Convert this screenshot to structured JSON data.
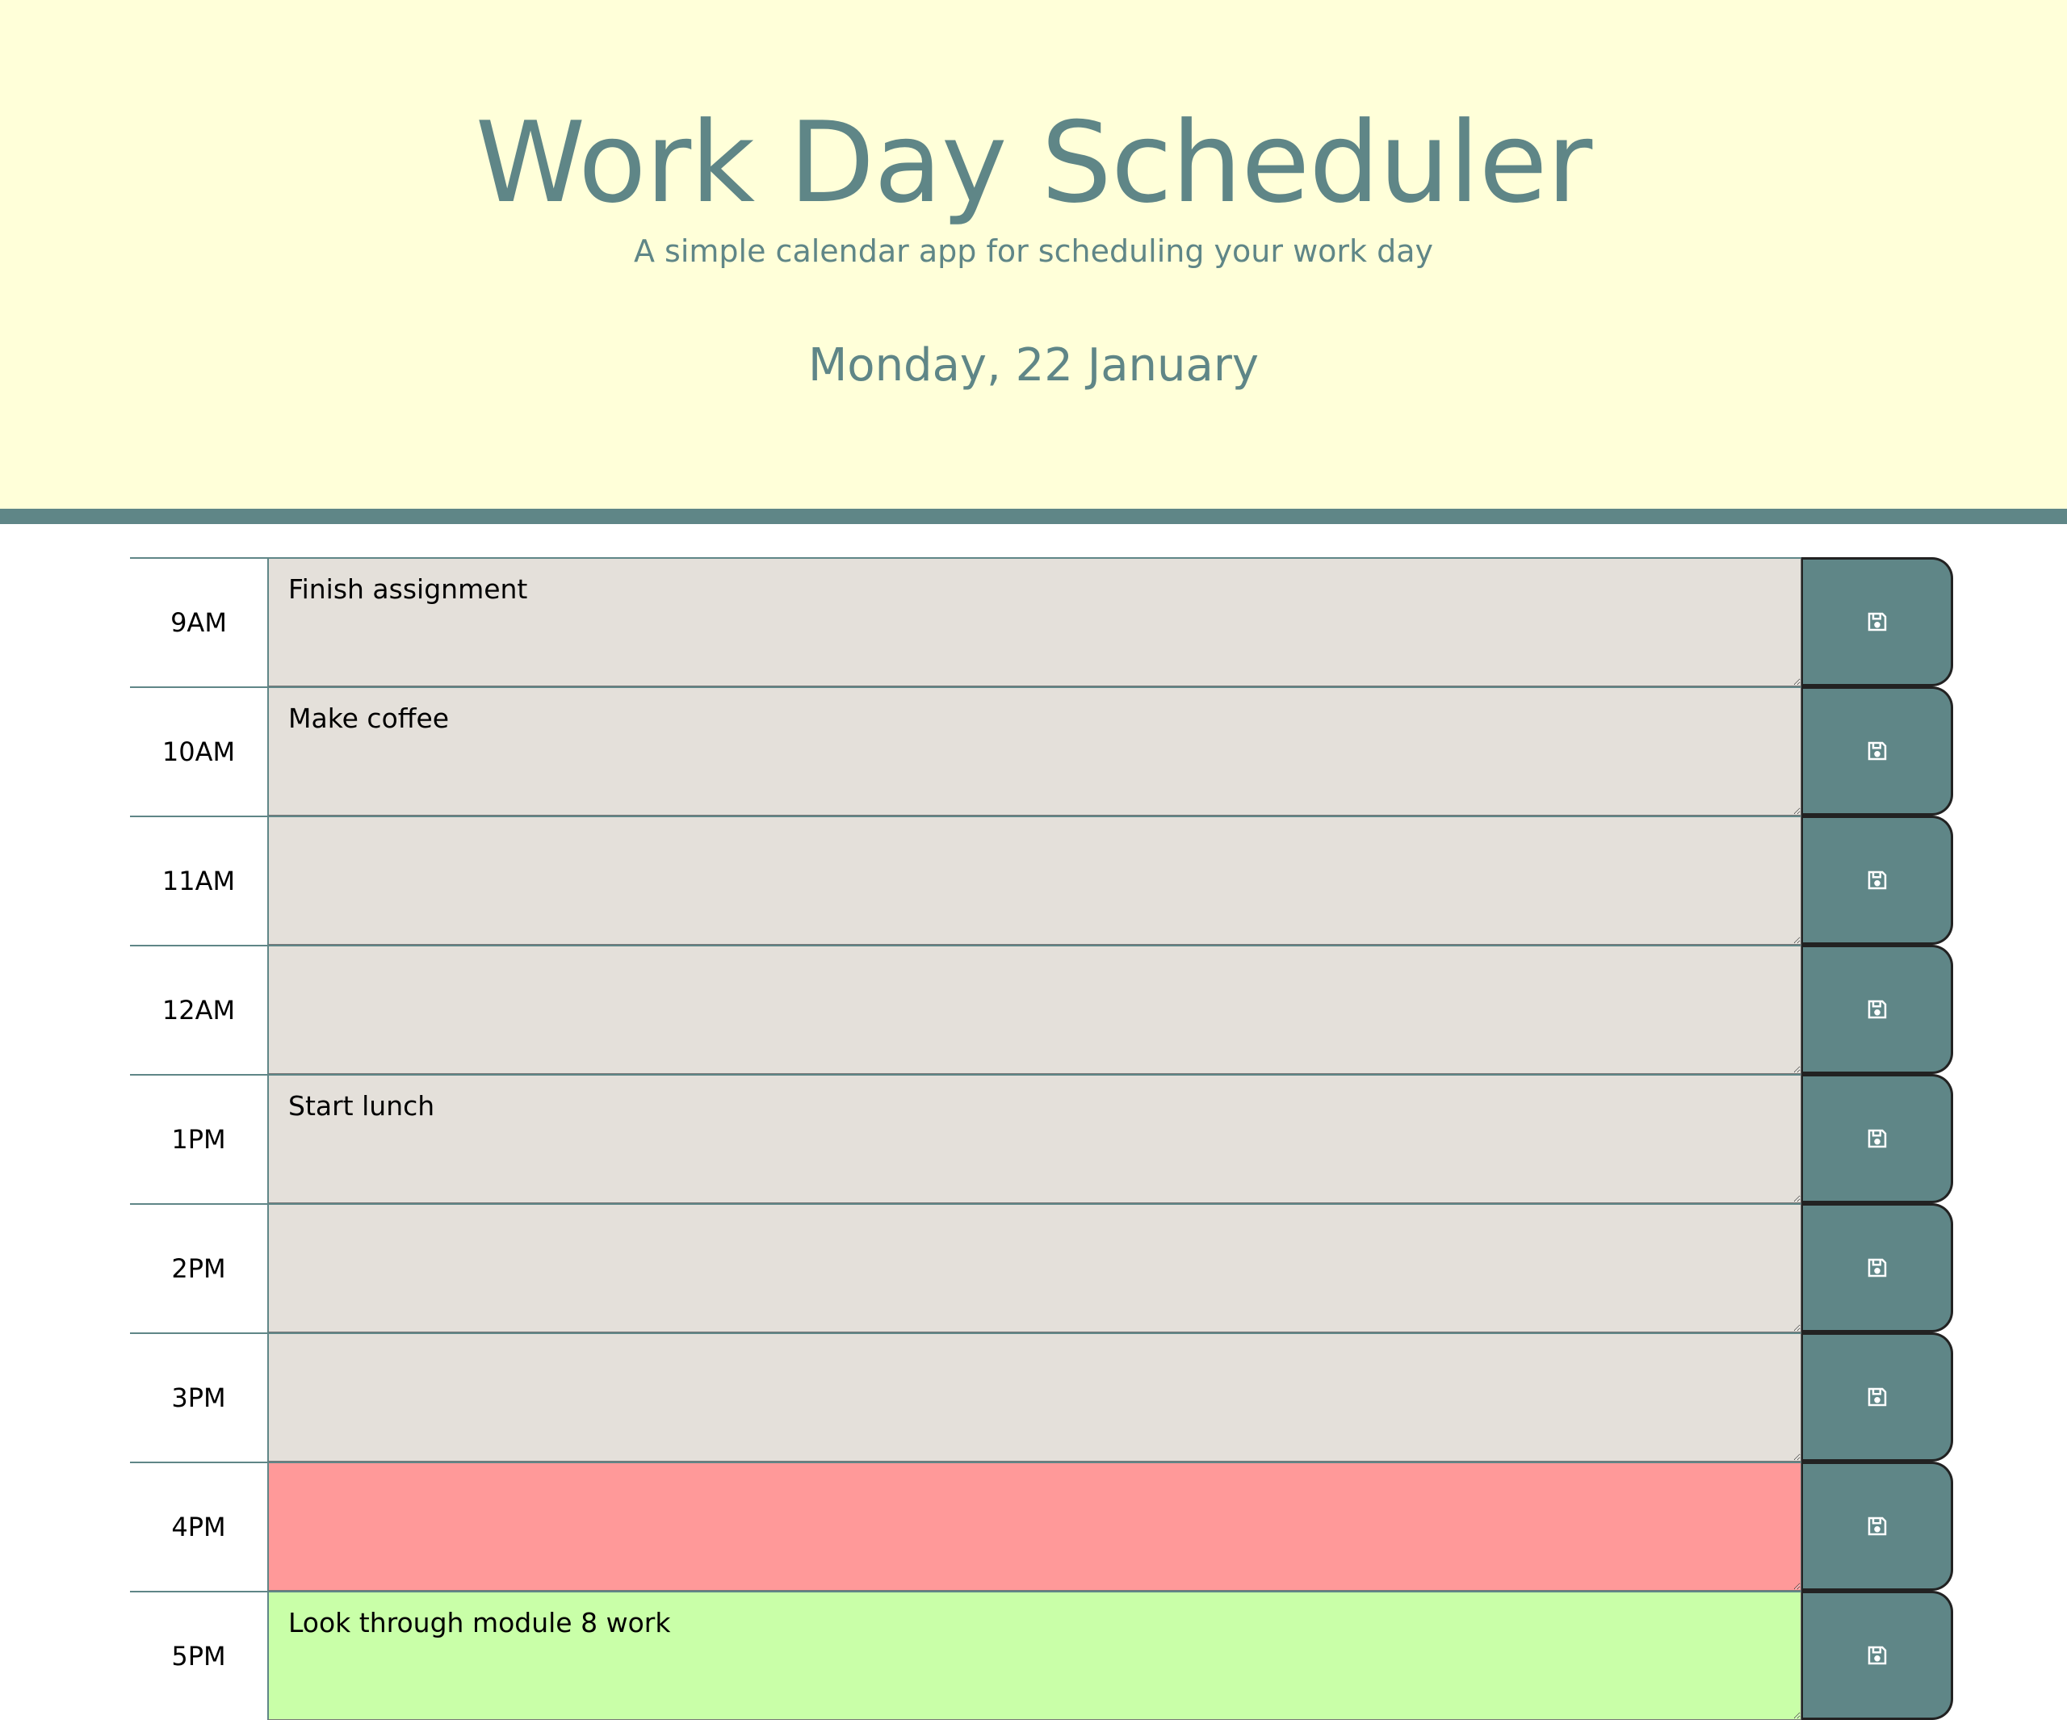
{
  "header": {
    "title": "Work Day Scheduler",
    "subtitle": "A simple calendar app for scheduling your work day",
    "current_date": "Monday, 22 January"
  },
  "colors": {
    "accent": "#5f8687",
    "header_bg": "#ffffd9",
    "past": "#e4e0da",
    "present": "#ff9999",
    "future": "#c9ffa8"
  },
  "rows": [
    {
      "hour": "9AM",
      "text": "Finish assignment",
      "state": "past"
    },
    {
      "hour": "10AM",
      "text": "Make coffee",
      "state": "past"
    },
    {
      "hour": "11AM",
      "text": "",
      "state": "past"
    },
    {
      "hour": "12AM",
      "text": "",
      "state": "past"
    },
    {
      "hour": "1PM",
      "text": "Start lunch",
      "state": "past"
    },
    {
      "hour": "2PM",
      "text": "",
      "state": "past"
    },
    {
      "hour": "3PM",
      "text": "",
      "state": "past"
    },
    {
      "hour": "4PM",
      "text": "",
      "state": "present"
    },
    {
      "hour": "5PM",
      "text": "Look through module 8 work",
      "state": "future"
    }
  ],
  "save_icon": "floppy-disk-icon"
}
